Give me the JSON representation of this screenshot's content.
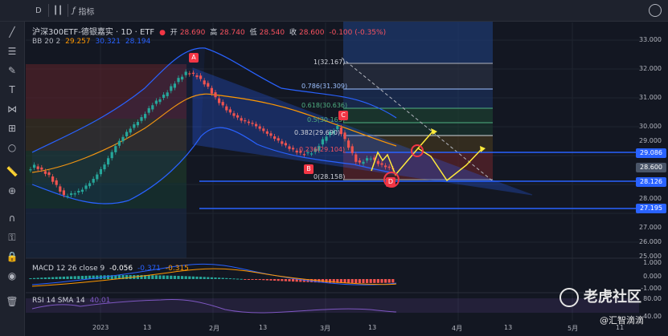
{
  "toolbar": {
    "timeframe": "D",
    "indicators_label": "指标",
    "tools": [
      "crosshair-icon",
      "trendline-icon",
      "fib-icon",
      "brush-icon",
      "text-icon",
      "pattern-icon",
      "prediction-icon",
      "circle-icon",
      "ruler-icon",
      "zoom-icon",
      "magnet-icon",
      "lock-icon",
      "lock2-icon",
      "eye-icon",
      "trash-icon"
    ]
  },
  "header": {
    "symbol": "沪深300ETF-德银嘉实 · 1D · ETF",
    "open_label": "开",
    "open": "28.690",
    "high_label": "高",
    "high": "28.740",
    "low_label": "低",
    "low": "28.540",
    "close_label": "收",
    "close": "28.600",
    "change": "-0.100 (-0.35%)"
  },
  "bb": {
    "label": "BB 20 2",
    "basis": "29.257",
    "upper": "30.321",
    "lower": "28.194"
  },
  "macd": {
    "label": "MACD 12 26 close 9",
    "v1": "-0.056",
    "v2": "-0.371",
    "v3": "-0.315"
  },
  "rsi": {
    "label": "RSI 14 SMA 14",
    "value": "40.01"
  },
  "fib": {
    "levels": [
      {
        "label": "1(32.167)",
        "color": "#b2b5be"
      },
      {
        "label": "0.786(31.309)",
        "color": "#9cc0ff"
      },
      {
        "label": "0.618(30.636)",
        "color": "#4fb082"
      },
      {
        "label": "0.5(30.163)",
        "color": "#4fb082"
      },
      {
        "label": "0.382(29.690)",
        "color": "#d1d4dc"
      },
      {
        "label": "0.236(29.104)",
        "color": "#f7525f"
      },
      {
        "label": "0(28.158)",
        "color": "#b2b5be"
      }
    ]
  },
  "markers": [
    "A",
    "B",
    "C",
    "D"
  ],
  "price_axis": [
    "33.000",
    "32.000",
    "31.000",
    "30.000",
    "29.000",
    "28.000",
    "27.000",
    "26.000",
    "25.000"
  ],
  "price_boxes": [
    {
      "value": "29.086",
      "color": "#2962ff"
    },
    {
      "value": "28.600",
      "color": "#4a5568"
    },
    {
      "value": "28.126",
      "color": "#2962ff"
    },
    {
      "value": "27.195",
      "color": "#2962ff"
    }
  ],
  "indicator_axis": [
    "1.000",
    "0.000",
    "-1.000",
    "80.00",
    "40.00"
  ],
  "time_axis": [
    "2023",
    "13",
    "2月",
    "13",
    "3月",
    "13",
    "4月",
    "13",
    "5月",
    "11"
  ],
  "watermark": {
    "brand": "老虎社区",
    "user": "@汇智滴滴"
  },
  "colors": {
    "up": "#26a69a",
    "down": "#ef5350",
    "upper": "#2962ff",
    "basis": "#ff9800",
    "fan": "#2962ff"
  }
}
